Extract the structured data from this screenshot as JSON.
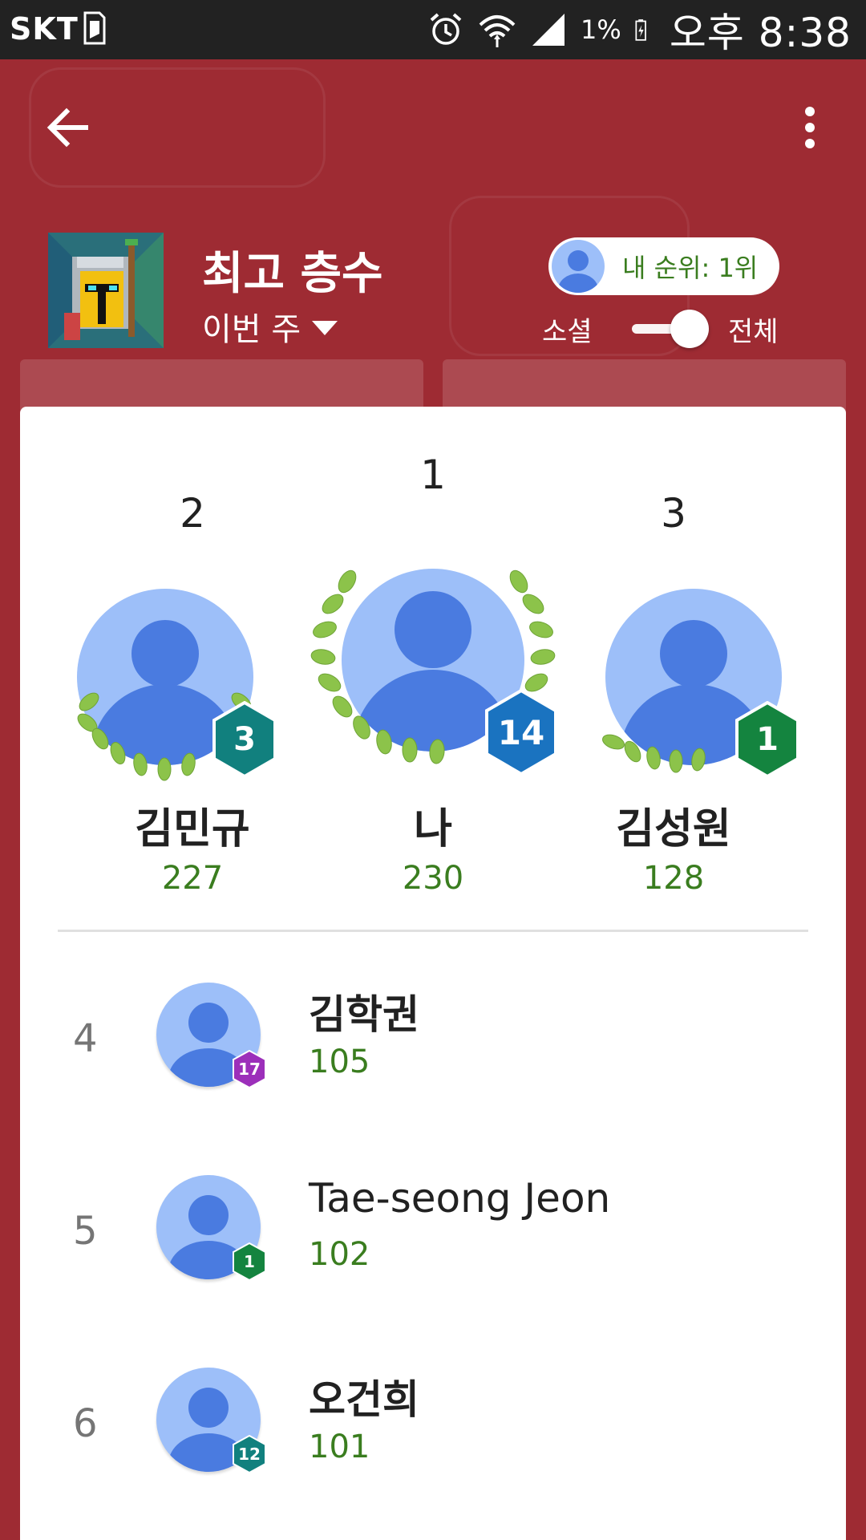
{
  "status_bar": {
    "carrier": "SKT",
    "battery_percent": "1%",
    "time": "오후 8:38"
  },
  "header": {
    "title": "최고 층수",
    "period": "이번 주",
    "my_rank": "내 순위: 1위",
    "toggle_left": "소셜",
    "toggle_right": "전체"
  },
  "podium": [
    {
      "rank": "2",
      "name": "김민규",
      "score": "227",
      "level": "3",
      "badge_color": "#11807e"
    },
    {
      "rank": "1",
      "name": "나",
      "score": "230",
      "level": "14",
      "badge_color": "#1a73c0"
    },
    {
      "rank": "3",
      "name": "김성원",
      "score": "128",
      "level": "1",
      "badge_color": "#14843f"
    }
  ],
  "list": [
    {
      "rank": "4",
      "name": "김학권",
      "score": "105",
      "level": "17",
      "badge_color": "#9c2fba"
    },
    {
      "rank": "5",
      "name": "Tae-seong Jeon",
      "score": "102",
      "level": "1",
      "badge_color": "#14843f"
    },
    {
      "rank": "6",
      "name": "오건희",
      "score": "101",
      "level": "12",
      "badge_color": "#11807e"
    }
  ],
  "colors": {
    "background": "#9e2b33",
    "score_green": "#3a7d1f",
    "avatar_bg": "#9dbff9",
    "avatar_fg": "#4a7be0",
    "laurel": "#8cc34a"
  }
}
